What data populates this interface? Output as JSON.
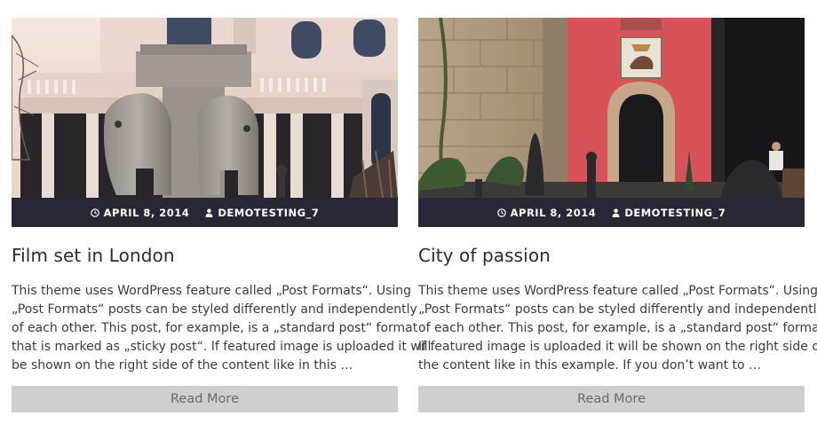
{
  "posts": [
    {
      "date": "APRIL 8, 2014",
      "author": "DEMOTESTING_7",
      "title": "Film set in London",
      "excerpt_lines": [
        "This theme uses WordPress feature called „Post Formats“. Using",
        "„Post Formats“ posts can be styled differently and independently",
        "of each other. This post, for example, is a „standard post“ format",
        "that is marked as „sticky post“. If featured image is uploaded it will",
        "be shown on the right side of the content like in this …"
      ],
      "read_more": "Read More"
    },
    {
      "date": "APRIL 8, 2014",
      "author": "DEMOTESTING_7",
      "title": "City of passion",
      "excerpt_lines": [
        "This theme uses WordPress feature called „Post Formats“. Using",
        "„Post Formats“ posts can be styled differently and independently",
        "of each other. This post, for example, is a „standard post“ format.",
        "If featured image is uploaded it will be shown on the right side of",
        "the content like in this example. If you don’t want to …"
      ],
      "read_more": "Read More"
    }
  ],
  "icons": {
    "date": "clock-icon",
    "author": "user-icon"
  },
  "colors": {
    "meta_bar": "#272735",
    "read_more_bg": "#cfcfcf",
    "read_more_text": "#6a6a70",
    "title": "#2b2b35"
  }
}
